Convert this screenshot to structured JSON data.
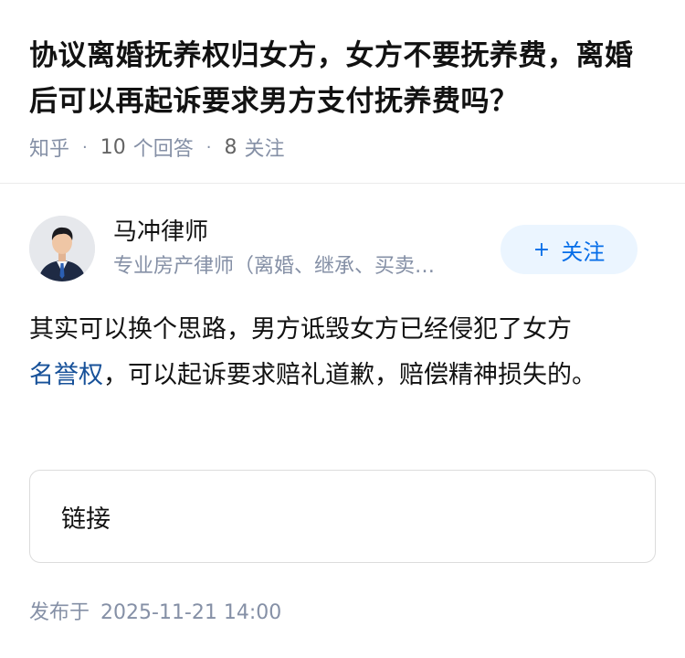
{
  "question": {
    "title": "协议离婚抚养权归女方，女方不要抚养费，离婚后可以再起诉要求男方支付抚养费吗？",
    "site": "知乎",
    "answer_count": "10",
    "answer_label": "个回答",
    "follower_count": "8",
    "follower_label": "关注",
    "separator": "·"
  },
  "author": {
    "name": "马冲律师",
    "bio": "专业房产律师（离婚、继承、买卖…",
    "follow_icon": "plus-icon",
    "follow_label": "关注"
  },
  "answer": {
    "text_before": "其实可以换个思路，男方诋毁女方已经侵犯了女方",
    "link_text": "名誉权",
    "text_after": "，可以起诉要求赔礼道歉，赔偿精神损失的。"
  },
  "link_card": {
    "label": "链接"
  },
  "publish": {
    "label": "发布于",
    "timestamp": "2025-11-21 14:00"
  },
  "colors": {
    "link": "#175199",
    "accent": "#056de8",
    "follow_bg": "#ebf5ff",
    "meta": "#8590a6"
  }
}
